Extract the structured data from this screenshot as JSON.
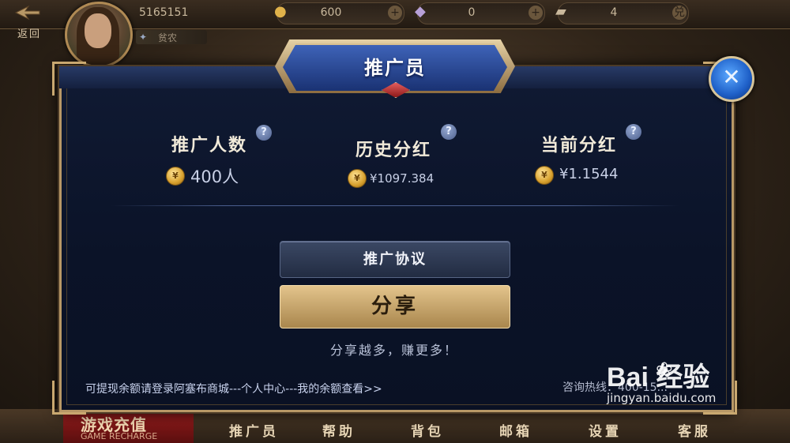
{
  "topbar": {
    "back_label": "返回",
    "user_id": "5165151",
    "rank_label": "贫农",
    "resources": [
      {
        "icon": "gold-icon",
        "value": "600"
      },
      {
        "icon": "diamond-icon",
        "value": "0"
      },
      {
        "icon": "ticket-icon",
        "value": "4"
      }
    ],
    "plus_label": "+"
  },
  "modal": {
    "title": "推广员",
    "close_label": "✕",
    "stats": [
      {
        "label": "推广人数",
        "value": "400人"
      },
      {
        "label": "历史分红",
        "value": "¥1097.384"
      },
      {
        "label": "当前分红",
        "value": "¥1.1544"
      }
    ],
    "help_label": "?",
    "agreement_button": "推广协议",
    "share_button": "分享",
    "slogan": "分享越多，赚更多！",
    "footer_link": "可提现余额请登录阿塞布商城---个人中心---我的余额查看>>",
    "hotline": "咨询热线：400-15..."
  },
  "bottombar": {
    "recharge_title": "游戏充值",
    "recharge_sub": "GAME RECHARGE",
    "tabs": [
      "推广员",
      "帮助",
      "背包",
      "邮箱",
      "设置",
      "客服"
    ]
  },
  "watermark": {
    "logo": "Bai 经验",
    "url": "jingyan.baidu.com"
  },
  "colors": {
    "modal_bg": "#0b1328",
    "gold_border": "#b89866",
    "title_blue": "#1a3273",
    "share_gold": "#d3b07a"
  }
}
